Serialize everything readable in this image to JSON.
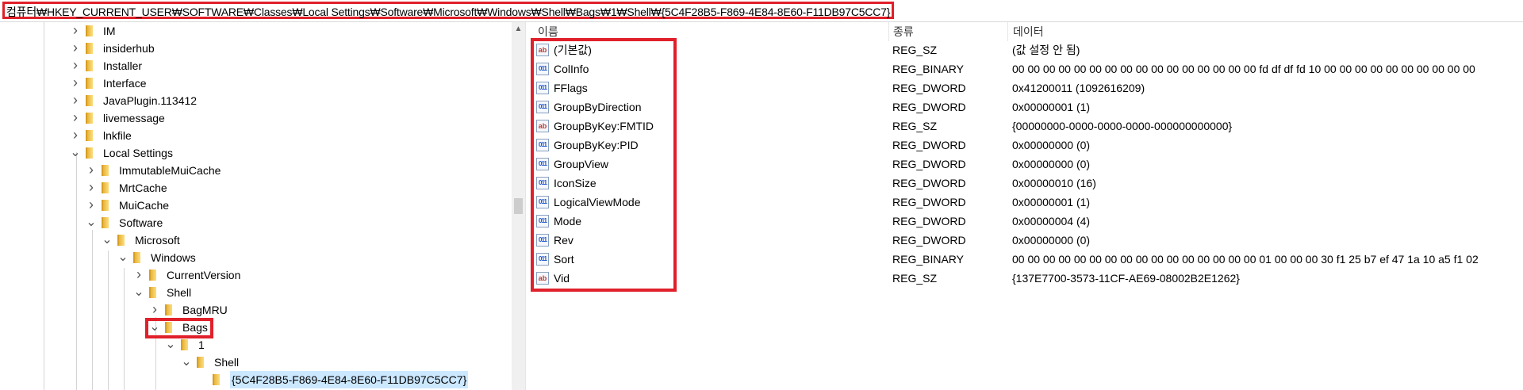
{
  "address": {
    "path": "컴퓨터₩HKEY_CURRENT_USER₩SOFTWARE₩Classes₩Local Settings₩Software₩Microsoft₩Windows₩Shell₩Bags₩1₩Shell₩{5C4F28B5-F869-4E84-8E60-F11DB97C5CC7}"
  },
  "tree": {
    "items": [
      {
        "label": "IM",
        "state": "collapsed"
      },
      {
        "label": "insiderhub",
        "state": "collapsed"
      },
      {
        "label": "Installer",
        "state": "collapsed"
      },
      {
        "label": "Interface",
        "state": "collapsed"
      },
      {
        "label": "JavaPlugin.113412",
        "state": "collapsed"
      },
      {
        "label": "livemessage",
        "state": "collapsed"
      },
      {
        "label": "lnkfile",
        "state": "collapsed"
      },
      {
        "label": "Local Settings",
        "state": "expanded"
      },
      {
        "label": "ImmutableMuiCache",
        "state": "collapsed"
      },
      {
        "label": "MrtCache",
        "state": "collapsed"
      },
      {
        "label": "MuiCache",
        "state": "collapsed"
      },
      {
        "label": "Software",
        "state": "expanded"
      },
      {
        "label": "Microsoft",
        "state": "expanded"
      },
      {
        "label": "Windows",
        "state": "expanded"
      },
      {
        "label": "CurrentVersion",
        "state": "collapsed"
      },
      {
        "label": "Shell",
        "state": "expanded"
      },
      {
        "label": "BagMRU",
        "state": "collapsed"
      },
      {
        "label": "Bags",
        "state": "expanded"
      },
      {
        "label": "1",
        "state": "expanded"
      },
      {
        "label": "Shell",
        "state": "expanded"
      },
      {
        "label": "{5C4F28B5-F869-4E84-8E60-F11DB97C5CC7}",
        "state": "leaf-selected"
      }
    ]
  },
  "values": {
    "columns": {
      "name": "이름",
      "type": "종류",
      "data": "데이터"
    },
    "rows": [
      {
        "icon": "string-value-icon",
        "name": "(기본값)",
        "type": "REG_SZ",
        "data": "(값 설정 안 됨)"
      },
      {
        "icon": "binary-value-icon",
        "name": "ColInfo",
        "type": "REG_BINARY",
        "data": "00 00 00 00 00 00 00 00 00 00 00 00 00 00 00 00 fd df df fd 10 00 00 00 00 00 00 00 00 00 00"
      },
      {
        "icon": "binary-value-icon",
        "name": "FFlags",
        "type": "REG_DWORD",
        "data": "0x41200011 (1092616209)"
      },
      {
        "icon": "binary-value-icon",
        "name": "GroupByDirection",
        "type": "REG_DWORD",
        "data": "0x00000001 (1)"
      },
      {
        "icon": "string-value-icon",
        "name": "GroupByKey:FMTID",
        "type": "REG_SZ",
        "data": "{00000000-0000-0000-0000-000000000000}"
      },
      {
        "icon": "binary-value-icon",
        "name": "GroupByKey:PID",
        "type": "REG_DWORD",
        "data": "0x00000000 (0)"
      },
      {
        "icon": "binary-value-icon",
        "name": "GroupView",
        "type": "REG_DWORD",
        "data": "0x00000000 (0)"
      },
      {
        "icon": "binary-value-icon",
        "name": "IconSize",
        "type": "REG_DWORD",
        "data": "0x00000010 (16)"
      },
      {
        "icon": "binary-value-icon",
        "name": "LogicalViewMode",
        "type": "REG_DWORD",
        "data": "0x00000001 (1)"
      },
      {
        "icon": "binary-value-icon",
        "name": "Mode",
        "type": "REG_DWORD",
        "data": "0x00000004 (4)"
      },
      {
        "icon": "binary-value-icon",
        "name": "Rev",
        "type": "REG_DWORD",
        "data": "0x00000000 (0)"
      },
      {
        "icon": "binary-value-icon",
        "name": "Sort",
        "type": "REG_BINARY",
        "data": "00 00 00 00 00 00 00 00 00 00 00 00 00 00 00 00 01 00 00 00 30 f1 25 b7 ef 47 1a 10 a5 f1 02"
      },
      {
        "icon": "string-value-icon",
        "name": "Vid",
        "type": "REG_SZ",
        "data": "{137E7700-3573-11CF-AE69-08002B2E1262}"
      }
    ]
  },
  "icon_glyphs": {
    "string": "ab",
    "binary": "011"
  },
  "colors": {
    "highlight_border": "#e0202a",
    "selection": "#cce8ff",
    "folder": "#f6d26a"
  }
}
